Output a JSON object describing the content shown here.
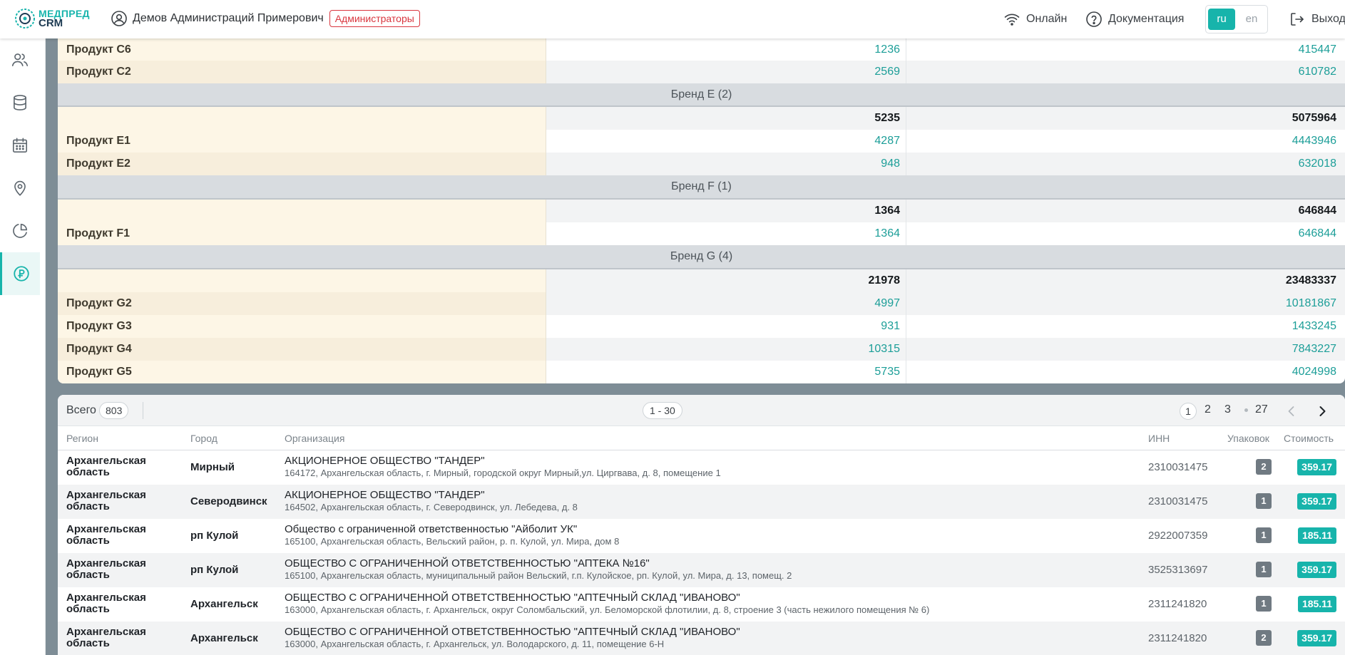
{
  "header": {
    "logo_line1": "МЕДПРЕД",
    "logo_line2": "CRM",
    "user_name": "Демов Администраций Примерович",
    "role": "Администраторы",
    "online_label": "Онлайн",
    "docs_label": "Документация",
    "lang_ru": "ru",
    "lang_en": "en",
    "logout_label": "Выход"
  },
  "sidebar": {
    "items": [
      {
        "icon": "users-icon"
      },
      {
        "icon": "database-icon"
      },
      {
        "icon": "calendar-icon"
      },
      {
        "icon": "location-pin-icon"
      },
      {
        "icon": "pie-chart-icon"
      },
      {
        "icon": "ruble-coin-icon",
        "active": true
      }
    ],
    "accent": "#17b4ab"
  },
  "summary_table": {
    "rows_top": [
      {
        "name": "Продукт C6",
        "qty": "1236",
        "sum": "415447"
      },
      {
        "name": "Продукт C2",
        "qty": "2569",
        "sum": "610782"
      }
    ],
    "brands": [
      {
        "title": "Бренд E (2)",
        "total_qty": "5235",
        "total_sum": "5075964",
        "products": [
          {
            "name": "Продукт E1",
            "qty": "4287",
            "sum": "4443946"
          },
          {
            "name": "Продукт E2",
            "qty": "948",
            "sum": "632018"
          }
        ]
      },
      {
        "title": "Бренд F (1)",
        "total_qty": "1364",
        "total_sum": "646844",
        "products": [
          {
            "name": "Продукт F1",
            "qty": "1364",
            "sum": "646844"
          }
        ]
      },
      {
        "title": "Бренд G (4)",
        "total_qty": "21978",
        "total_sum": "23483337",
        "products": [
          {
            "name": "Продукт G2",
            "qty": "4997",
            "sum": "10181867"
          },
          {
            "name": "Продукт G3",
            "qty": "931",
            "sum": "1433245"
          },
          {
            "name": "Продукт G4",
            "qty": "10315",
            "sum": "7843227"
          },
          {
            "name": "Продукт G5",
            "qty": "5735",
            "sum": "4024998"
          }
        ]
      }
    ]
  },
  "list": {
    "total_label": "Всего",
    "total_count": "803",
    "range": "1 - 30",
    "pages": [
      "1",
      "2",
      "3",
      "27"
    ],
    "current_page": "1",
    "columns": {
      "region": "Регион",
      "city": "Город",
      "org": "Организация",
      "inn": "ИНН",
      "packs": "Упаковок",
      "cost": "Стоимость"
    },
    "rows": [
      {
        "region": "Архангельская область",
        "city": "Мирный",
        "org": "АКЦИОНЕРНОЕ ОБЩЕСТВО \"ТАНДЕР\"",
        "address": "164172, Архангельская область, г. Мирный, городской округ Мирный,ул. Циргвава, д. 8, помещение 1",
        "inn": "2310031475",
        "packs": "2",
        "cost": "359.17"
      },
      {
        "region": "Архангельская область",
        "city": "Северодвинск",
        "org": "АКЦИОНЕРНОЕ ОБЩЕСТВО \"ТАНДЕР\"",
        "address": "164502, Архангельская область, г. Северодвинск, ул. Лебедева, д. 8",
        "inn": "2310031475",
        "packs": "1",
        "cost": "359.17"
      },
      {
        "region": "Архангельская область",
        "city": "рп Кулой",
        "org": "Общество с ограниченной ответственностью \"Айболит УК\"",
        "address": "165100, Архангельская область, Вельский район, р. п. Кулой, ул. Мира, дом 8",
        "inn": "2922007359",
        "packs": "1",
        "cost": "185.11"
      },
      {
        "region": "Архангельская область",
        "city": "рп Кулой",
        "org": "ОБЩЕСТВО С ОГРАНИЧЕННОЙ ОТВЕТСТВЕННОСТЬЮ \"АПТЕКА №16\"",
        "address": "165100, Архангельская область, муниципальный район Вельский, г.п. Кулойское, рп. Кулой, ул. Мира, д. 13, помещ. 2",
        "inn": "3525313697",
        "packs": "1",
        "cost": "359.17"
      },
      {
        "region": "Архангельская область",
        "city": "Архангельск",
        "org": "ОБЩЕСТВО С ОГРАНИЧЕННОЙ ОТВЕТСТВЕННОСТЬЮ \"АПТЕЧНЫЙ СКЛАД \"ИВАНОВО\"",
        "address": "163000, Архангельская область, г. Архангельск, округ Соломбальский, ул. Беломорской флотилии, д. 8, строение 3 (часть нежилого помещения № 6)",
        "inn": "2311241820",
        "packs": "1",
        "cost": "185.11"
      },
      {
        "region": "Архангельская область",
        "city": "Архангельск",
        "org": "ОБЩЕСТВО С ОГРАНИЧЕННОЙ ОТВЕТСТВЕННОСТЬЮ \"АПТЕЧНЫЙ СКЛАД \"ИВАНОВО\"",
        "address": "163000, Архангельская область, г. Архангельск, ул. Володарского, д. 11, помещение 6-Н",
        "inn": "2311241820",
        "packs": "2",
        "cost": "359.17"
      }
    ]
  }
}
